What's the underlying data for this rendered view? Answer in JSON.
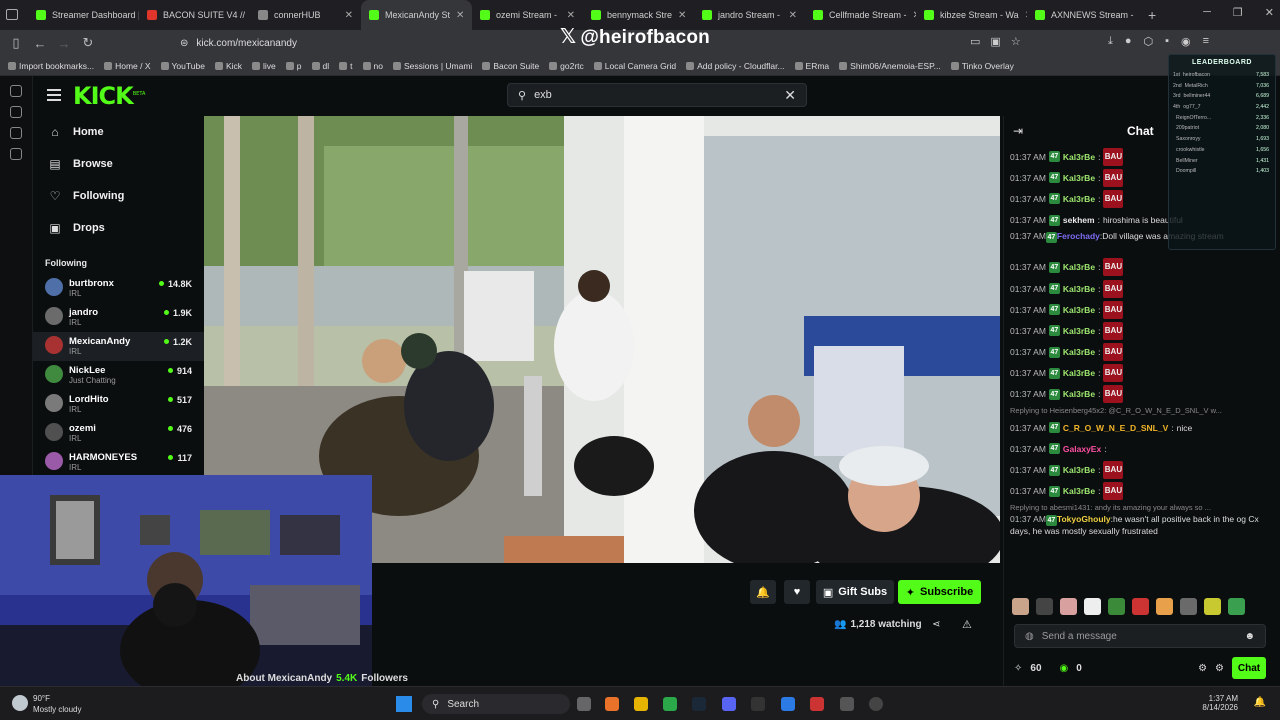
{
  "browser": {
    "tabs": [
      {
        "label": "Streamer Dashboard | Ta",
        "color": "#53fc18",
        "active": false
      },
      {
        "label": "BACON SUITE V4 // ",
        "color": "#e0352b",
        "active": false
      },
      {
        "label": "connerHUB",
        "color": "#888888",
        "active": false
      },
      {
        "label": "MexicanAndy St",
        "color": "#53fc18",
        "active": true
      },
      {
        "label": "ozemi Stream - ",
        "color": "#53fc18",
        "active": false
      },
      {
        "label": "bennymack Stre",
        "color": "#53fc18",
        "active": false
      },
      {
        "label": "jandro Stream - ",
        "color": "#53fc18",
        "active": false
      },
      {
        "label": "Cellfmade Stream - ",
        "color": "#53fc18",
        "active": false
      },
      {
        "label": "kibzee Stream - Wa",
        "color": "#53fc18",
        "active": false
      },
      {
        "label": "AXNNEWS Stream - ",
        "color": "#53fc18",
        "active": false
      }
    ],
    "url": "kick.com/mexicanandy",
    "overlay_handle": "@heirofbacon",
    "bookmarks": [
      "Import bookmarks...",
      "Home / X",
      "YouTube",
      "Kick",
      "live",
      "p",
      "dl",
      "t",
      "no",
      "Sessions | Umami",
      "Bacon Suite",
      "go2rtc",
      "Local Camera Grid",
      "Add policy - Cloudflar...",
      "ERma",
      "Shim06/Anemoia-ESP...",
      "Tinko Overlay"
    ]
  },
  "kick": {
    "logo": "KICK",
    "logo_tag": "BETA",
    "search_value": "exb",
    "nav": [
      {
        "label": "Home",
        "icon": "home-icon",
        "glyph": "⌂"
      },
      {
        "label": "Browse",
        "icon": "browse-icon",
        "glyph": "▤"
      },
      {
        "label": "Following",
        "icon": "heart-icon",
        "glyph": "♡"
      },
      {
        "label": "Drops",
        "icon": "drops-icon",
        "glyph": "▣"
      }
    ],
    "following_title": "Following",
    "following": [
      {
        "name": "burtbronx",
        "category": "IRL",
        "viewers": "14.8K",
        "color": "#4e6fa8"
      },
      {
        "name": "jandro",
        "category": "IRL",
        "viewers": "1.9K",
        "color": "#6b6b6b"
      },
      {
        "name": "MexicanAndy",
        "category": "IRL",
        "viewers": "1.2K",
        "color": "#a83232",
        "selected": true
      },
      {
        "name": "NickLee",
        "category": "Just Chatting",
        "viewers": "914",
        "color": "#3f8a3f"
      },
      {
        "name": "LordHito",
        "category": "IRL",
        "viewers": "517",
        "color": "#7a7a7a"
      },
      {
        "name": "ozemi",
        "category": "IRL",
        "viewers": "476",
        "color": "#505050"
      },
      {
        "name": "HARMONEYES",
        "category": "IRL",
        "viewers": "117",
        "color": "#9a5aa8"
      }
    ]
  },
  "stream": {
    "buttons": {
      "gift": "Gift Subs",
      "subscribe": "Subscribe"
    },
    "watching": "1,218 watching",
    "about_prefix": "About MexicanAndy",
    "followers_count": "5.4K",
    "followers_label": "Followers"
  },
  "chat": {
    "title": "Chat",
    "messages": [
      {
        "time": "01:37 AM",
        "user": "Kal3rBe",
        "color": "#9fe870",
        "bau": true
      },
      {
        "time": "01:37 AM",
        "user": "Kal3rBe",
        "color": "#9fe870",
        "bau": true
      },
      {
        "time": "01:37 AM",
        "user": "Kal3rBe",
        "color": "#9fe870",
        "bau": true
      },
      {
        "time": "01:37 AM",
        "user": "sekhem",
        "color": "#e8e8e8",
        "text": "hiroshima is beautiful"
      },
      {
        "time": "01:37 AM",
        "user": "Ferochady",
        "color": "#7d6cf2",
        "text": "Doll village was amazing stream",
        "tall": true
      },
      {
        "time": "01:37 AM",
        "user": "Kal3rBe",
        "color": "#9fe870",
        "bau": true
      },
      {
        "time": "01:37 AM",
        "user": "Kal3rBe",
        "color": "#9fe870",
        "bau": true
      },
      {
        "time": "01:37 AM",
        "user": "Kal3rBe",
        "color": "#9fe870",
        "bau": true
      },
      {
        "time": "01:37 AM",
        "user": "Kal3rBe",
        "color": "#9fe870",
        "bau": true
      },
      {
        "time": "01:37 AM",
        "user": "Kal3rBe",
        "color": "#9fe870",
        "bau": true
      },
      {
        "time": "01:37 AM",
        "user": "Kal3rBe",
        "color": "#9fe870",
        "bau": true
      },
      {
        "time": "01:37 AM",
        "user": "Kal3rBe",
        "color": "#9fe870",
        "bau": true
      },
      {
        "reply": "Replying to Heisenberg45x2: @C_R_O_W_N_E_D_SNL_V w..."
      },
      {
        "time": "01:37 AM",
        "user": "C_R_O_W_N_E_D_SNL_V",
        "color": "#f0b429",
        "text": "nice"
      },
      {
        "time": "01:37 AM",
        "user": "GalaxyEx",
        "color": "#ff4fa3",
        "text": ""
      },
      {
        "time": "01:37 AM",
        "user": "Kal3rBe",
        "color": "#9fe870",
        "bau": true
      },
      {
        "time": "01:37 AM",
        "user": "Kal3rBe",
        "color": "#9fe870",
        "bau": true
      },
      {
        "reply": "Replying to abesmi1431: andy its amazing your always so ..."
      },
      {
        "time": "01:37 AM",
        "user": "TokyoGhouly",
        "color": "#f0d040",
        "text": "he wasn't all positive back in the og Cx days, he was mostly sexually frustrated",
        "tall": true
      }
    ],
    "input_placeholder": "Send a message",
    "points": "60",
    "kick_points": "0",
    "send_label": "Chat"
  },
  "leaderboard": {
    "title": "LEADERBOARD",
    "rows": [
      {
        "rank": "1st",
        "name": "heirofbacon",
        "value": "7,583"
      },
      {
        "rank": "2nd",
        "name": "MetalRich",
        "value": "7,036"
      },
      {
        "rank": "3rd",
        "name": "bellminer44",
        "value": "6,689"
      },
      {
        "rank": "4th",
        "name": "og77_7",
        "value": "2,442"
      },
      {
        "rank": "",
        "name": "ReignOfTerro...",
        "value": "2,336"
      },
      {
        "rank": "",
        "name": "209patriot",
        "value": "2,080"
      },
      {
        "rank": "",
        "name": "Saxonroyy",
        "value": "1,693"
      },
      {
        "rank": "",
        "name": "crookwhistle",
        "value": "1,656"
      },
      {
        "rank": "",
        "name": "BellMiner",
        "value": "1,431"
      },
      {
        "rank": "",
        "name": "Doompill",
        "value": "1,403"
      }
    ]
  },
  "taskbar": {
    "weather_temp": "90°F",
    "weather_desc": "Mostly cloudy",
    "search": "Search",
    "time": "1:37 AM",
    "date": "8/14/2026"
  }
}
